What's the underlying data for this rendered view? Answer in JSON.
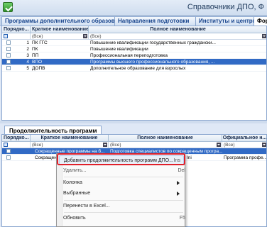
{
  "window": {
    "title": "Справочники ДПО, Ф"
  },
  "tabs": [
    {
      "label": "Программы дополнительного образования"
    },
    {
      "label": "Направления подготовки"
    },
    {
      "label": "Институты и центры"
    },
    {
      "label": "Фор"
    }
  ],
  "top_grid": {
    "headers": {
      "order": "Порядко...",
      "short": "Краткое наименование",
      "full": "Полное наименование"
    },
    "filter_all": "(Все)",
    "rows": [
      {
        "order": "1",
        "short": "ПК ГГС",
        "full": "Повышение квалификации государственных граждански..."
      },
      {
        "order": "2",
        "short": "ПК",
        "full": "Повышение квалификации"
      },
      {
        "order": "3",
        "short": "ПП",
        "full": "Профессиональная переподготовка"
      },
      {
        "order": "4",
        "short": "ВПО",
        "full": "Программы высшего профессионального образования, ..."
      },
      {
        "order": "5",
        "short": "ДОПВ",
        "full": "Дополнительное образование для взрослых"
      }
    ]
  },
  "bottom_panel": {
    "caption": "Продолжительность программ",
    "headers": {
      "order": "Порядко...",
      "short": "Краткое наименование",
      "full": "Полное наименование",
      "official": "Официальное н..."
    },
    "filter_all": "(Все)",
    "rows": [
      {
        "short": "Сокращенные программы на б...",
        "full": "Подготовка специалистов по сокращенным програ...",
        "official": ""
      },
      {
        "short": "Сокращен",
        "full": "Ini",
        "official": "Программа профе..."
      }
    ]
  },
  "context_menu": {
    "items": [
      {
        "label": "Добавить продолжительность программ ДПО...",
        "shortcut": "Ins"
      },
      {
        "label": "Удалить...",
        "shortcut": "Del"
      },
      {
        "label": "Колонка"
      },
      {
        "label": "Выбранные"
      },
      {
        "label": "Перенести в Excel..."
      },
      {
        "label": "Обновить",
        "shortcut": "F5"
      }
    ]
  }
}
